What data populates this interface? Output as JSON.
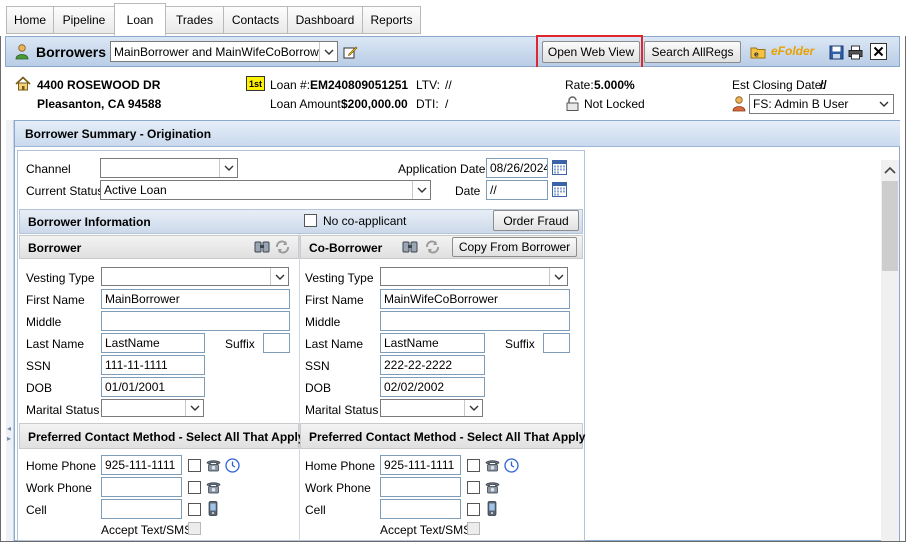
{
  "tabs": [
    "Home",
    "Pipeline",
    "Loan",
    "Trades",
    "Contacts",
    "Dashboard",
    "Reports"
  ],
  "active_tab": "Loan",
  "header": {
    "title": "Borrowers",
    "borrower_select": "MainBorrower and MainWifeCoBorrower L",
    "open_web_view": "Open Web View",
    "search_allregs": "Search AllRegs",
    "efolder": "eFolder"
  },
  "loan_info": {
    "address_line1": "4400 ROSEWOOD DR",
    "address_line2": "Pleasanton, CA 94588",
    "lien_badge": "1st",
    "loan_no_label": "Loan #:",
    "loan_no": "EM240809051251",
    "loan_amount_label": "Loan Amount:",
    "loan_amount": "$200,000.00",
    "ltv_label": "LTV:",
    "ltv": "//",
    "dti_label": "DTI:",
    "dti": "/",
    "rate_label": "Rate:",
    "rate": "5.000%",
    "lock_status": "Not Locked",
    "est_closing_label": "Est Closing Date:",
    "est_closing": "//",
    "user_select": "FS: Admin B User"
  },
  "section_title": "Borrower Summary - Origination",
  "origination": {
    "channel_label": "Channel",
    "channel_value": "",
    "current_status_label": "Current Status",
    "current_status_value": "Active Loan",
    "application_date_label": "Application Date",
    "application_date": "08/26/2024",
    "date_label": "Date",
    "date_value": "//"
  },
  "borrower_info": {
    "title": "Borrower Information",
    "no_coapplicant": "No co-applicant",
    "order_fraud": "Order Fraud"
  },
  "borrower": {
    "title": "Borrower",
    "vesting_type_label": "Vesting Type",
    "first_name_label": "First Name",
    "first_name": "MainBorrower",
    "middle_label": "Middle",
    "middle": "",
    "last_name_label": "Last Name",
    "last_name": "LastName",
    "suffix_label": "Suffix",
    "ssn_label": "SSN",
    "ssn": "111-11-1111",
    "dob_label": "DOB",
    "dob": "01/01/2001",
    "marital_label": "Marital Status"
  },
  "coborrower": {
    "title": "Co-Borrower",
    "copy_button": "Copy From Borrower",
    "vesting_type_label": "Vesting Type",
    "first_name_label": "First Name",
    "first_name": "MainWifeCoBorrower",
    "middle_label": "Middle",
    "middle": "",
    "last_name_label": "Last Name",
    "last_name": "LastName",
    "suffix_label": "Suffix",
    "ssn_label": "SSN",
    "ssn": "222-22-2222",
    "dob_label": "DOB",
    "dob": "02/02/2002",
    "marital_label": "Marital Status"
  },
  "contact": {
    "title": "Preferred Contact Method - Select All That Apply",
    "home_phone_label": "Home Phone",
    "work_phone_label": "Work Phone",
    "cell_label": "Cell",
    "accept_text_label": "Accept Text/SMS",
    "borrower_home_phone": "925-111-1111",
    "coborrower_home_phone": "925-111-1111"
  }
}
